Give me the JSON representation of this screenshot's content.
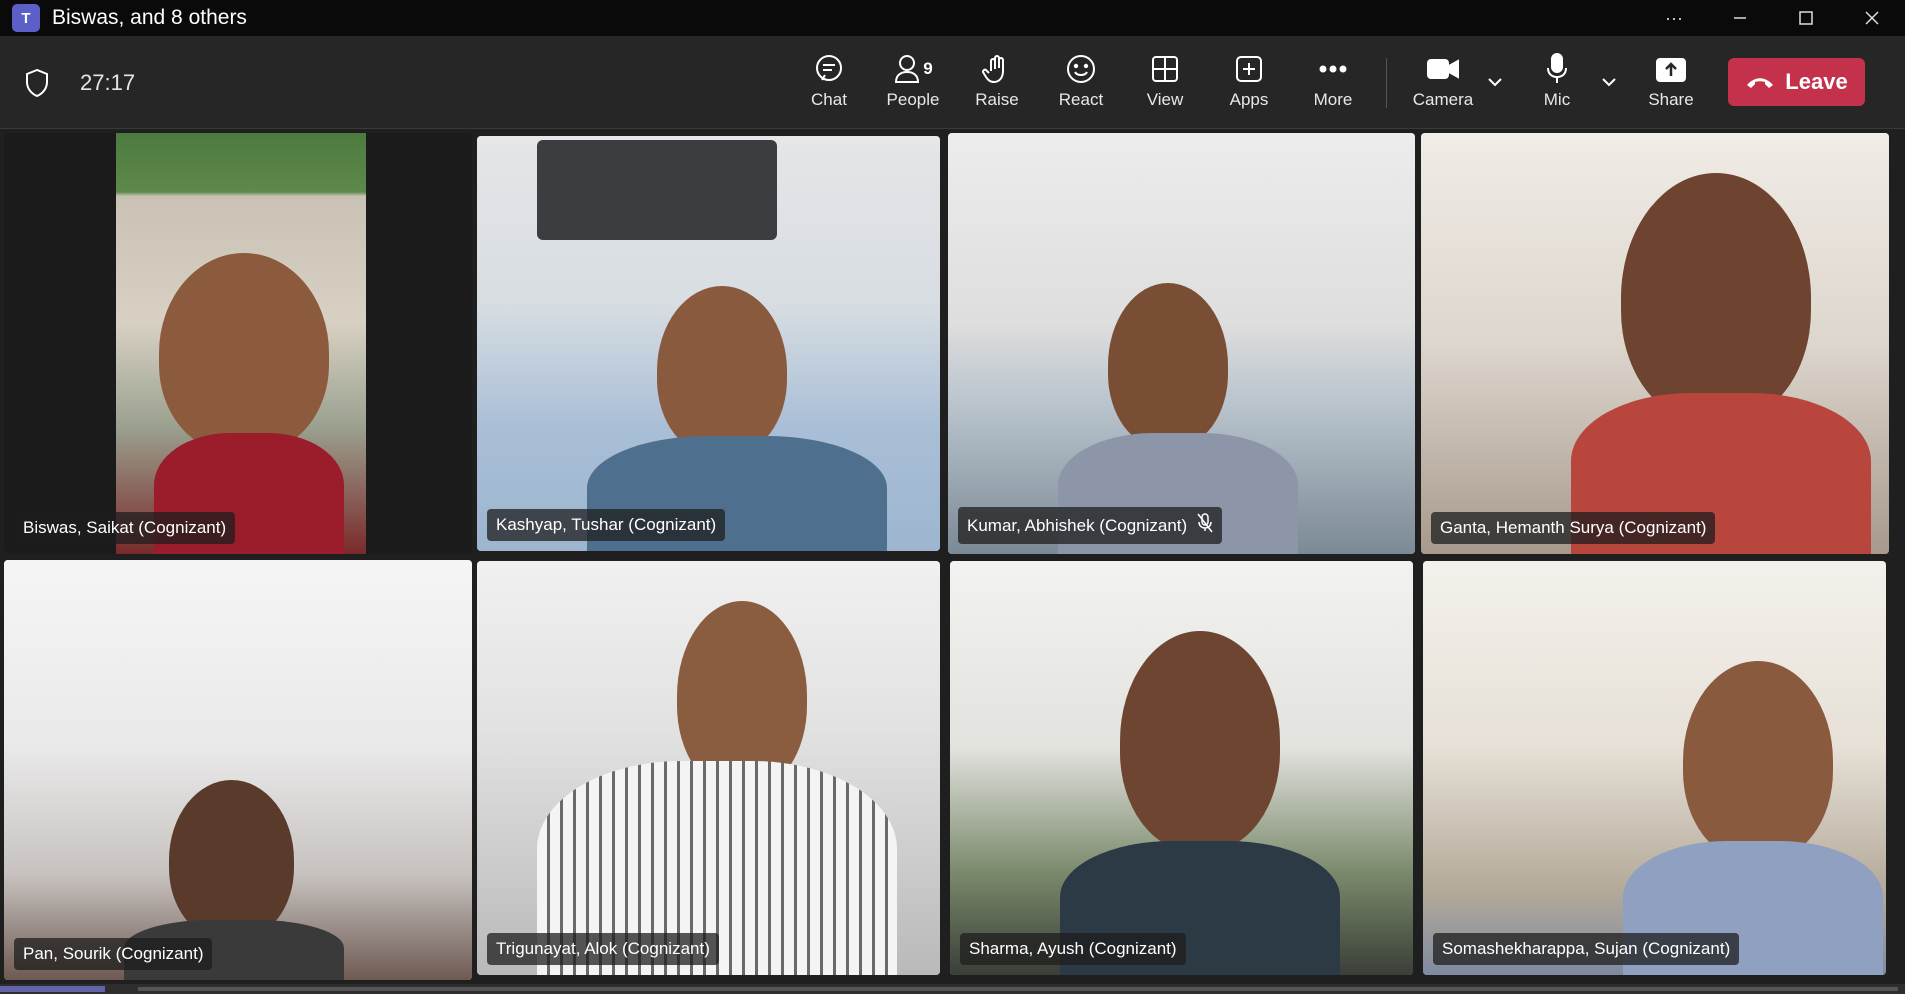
{
  "window": {
    "title": "Biswas, and 8 others",
    "controls": [
      "more-options",
      "minimize",
      "maximize",
      "close"
    ]
  },
  "toolbar": {
    "timer": "27:17",
    "buttons": {
      "chat": "Chat",
      "people": "People",
      "people_count": "9",
      "raise": "Raise",
      "react": "React",
      "view": "View",
      "apps": "Apps",
      "more": "More",
      "camera": "Camera",
      "mic": "Mic",
      "share": "Share",
      "leave": "Leave"
    },
    "colors": {
      "leave": "#c4314b",
      "accent": "#7f85f5"
    }
  },
  "participants": [
    {
      "name": "Biswas, Saikat (Cognizant)",
      "active": false,
      "muted": false
    },
    {
      "name": "Kashyap, Tushar (Cognizant)",
      "active": true,
      "muted": false
    },
    {
      "name": "Kumar, Abhishek (Cognizant)",
      "active": false,
      "muted": true
    },
    {
      "name": "Ganta, Hemanth Surya (Cognizant)",
      "active": false,
      "muted": false
    },
    {
      "name": "Pan, Sourik (Cognizant)",
      "active": false,
      "muted": false
    },
    {
      "name": "Trigunayat, Alok (Cognizant)",
      "active": true,
      "muted": false
    },
    {
      "name": "Sharma, Ayush (Cognizant)",
      "active": true,
      "muted": false
    },
    {
      "name": "Somashekharappa, Sujan (Cognizant)",
      "active": true,
      "muted": false
    }
  ]
}
